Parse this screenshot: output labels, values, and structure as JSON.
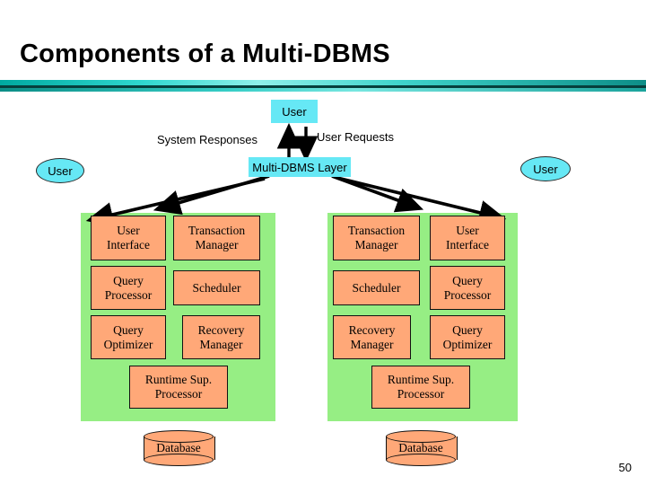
{
  "slide": {
    "title": "Components of a Multi-DBMS",
    "page_number": "50",
    "colors": {
      "box_fill": "#ffa878",
      "panel_fill": "#96ee84",
      "user_fill": "#66e8f5",
      "rule_gradient_start": "#00a9a0",
      "rule_gradient_end": "#0d8e87",
      "outline": "#111111"
    }
  },
  "labels": {
    "user_top": "User",
    "user_left": "User",
    "user_right": "User",
    "system_responses": "System Responses",
    "user_requests": "User Requests",
    "multi_dbms_layer": "Multi-DBMS Layer"
  },
  "left_site": {
    "components": [
      {
        "label": "User\nInterface",
        "line1": "User",
        "line2": "Interface"
      },
      {
        "label": "Transaction\nManager",
        "line1": "Transaction",
        "line2": "Manager"
      },
      {
        "label": "Query\nProcessor",
        "line1": "Query",
        "line2": "Processor"
      },
      {
        "label": "Scheduler",
        "line1": "Scheduler",
        "line2": ""
      },
      {
        "label": "Query\nOptimizer",
        "line1": "Query",
        "line2": "Optimizer"
      },
      {
        "label": "Recovery\nManager",
        "line1": "Recovery",
        "line2": "Manager"
      }
    ],
    "runtime": {
      "line1": "Runtime Sup.",
      "line2": "Processor"
    },
    "database": "Database"
  },
  "right_site": {
    "components": [
      {
        "label": "Transaction\nManager",
        "line1": "Transaction",
        "line2": "Manager"
      },
      {
        "label": "User\nInterface",
        "line1": "User",
        "line2": "Interface"
      },
      {
        "label": "Scheduler",
        "line1": "Scheduler",
        "line2": ""
      },
      {
        "label": "Query\nProcessor",
        "line1": "Query",
        "line2": "Processor"
      },
      {
        "label": "Recovery\nManager",
        "line1": "Recovery",
        "line2": "Manager"
      },
      {
        "label": "Query\nOptimizer",
        "line1": "Query",
        "line2": "Optimizer"
      }
    ],
    "runtime": {
      "line1": "Runtime Sup.",
      "line2": "Processor"
    },
    "database": "Database"
  }
}
